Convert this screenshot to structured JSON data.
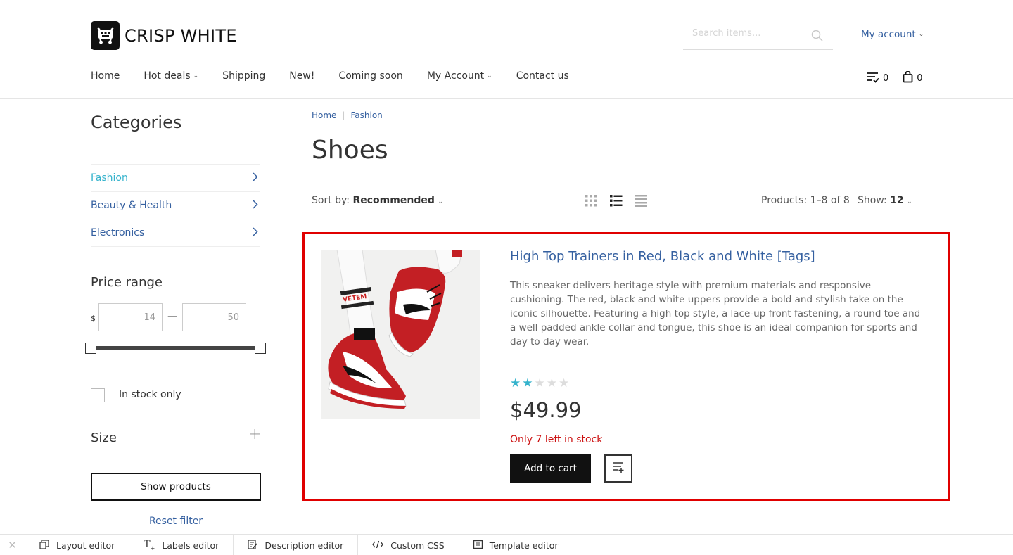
{
  "brand": {
    "name": "CRISP WHITE",
    "logo_icon": "cart-logo-icon"
  },
  "header": {
    "search_placeholder": "Search items...",
    "account_label": "My account",
    "favorites_count": "0",
    "cart_count": "0"
  },
  "nav": [
    {
      "label": "Home",
      "dropdown": false
    },
    {
      "label": "Hot deals",
      "dropdown": true
    },
    {
      "label": "Shipping",
      "dropdown": false
    },
    {
      "label": "New!",
      "dropdown": false
    },
    {
      "label": "Coming soon",
      "dropdown": false
    },
    {
      "label": "My Account",
      "dropdown": true
    },
    {
      "label": "Contact us",
      "dropdown": false
    }
  ],
  "sidebar": {
    "categories_title": "Categories",
    "categories": [
      {
        "label": "Fashion",
        "active": true
      },
      {
        "label": "Beauty & Health",
        "active": false
      },
      {
        "label": "Electronics",
        "active": false
      }
    ],
    "price_title": "Price range",
    "currency": "$",
    "price_min": "14",
    "price_max": "50",
    "in_stock_label": "In stock only",
    "size_title": "Size",
    "show_products_label": "Show products",
    "reset_label": "Reset filter"
  },
  "main": {
    "breadcrumb": [
      "Home",
      "Fashion"
    ],
    "title": "Shoes",
    "sort_prefix": "Sort by:",
    "sort_value": "Recommended",
    "products_count": "Products: 1–8 of 8",
    "show_prefix": "Show:",
    "show_value": "12"
  },
  "product": {
    "name": "High Top Trainers in Red, Black and White [Tags]",
    "description": "This sneaker delivers heritage style with premium materials and responsive cushioning. The red, black and white uppers provide a bold and stylish take on the iconic silhouette. Featuring a high top style, a lace-up front fastening, a round toe and a well padded ankle collar and tongue, this shoe is an ideal companion for sports and day to day wear.",
    "rating": 2,
    "rating_max": 5,
    "price": "$49.99",
    "stock_note": "Only 7 left in stock",
    "add_to_cart_label": "Add to cart",
    "sock_text": "VETEM",
    "accent_color": "#35b3cc",
    "highlight_color": "#e00000"
  },
  "toolbar": [
    {
      "label": "Layout editor",
      "icon": "layout-icon"
    },
    {
      "label": "Labels editor",
      "icon": "text-icon"
    },
    {
      "label": "Description editor",
      "icon": "edit-doc-icon"
    },
    {
      "label": "Custom CSS",
      "icon": "code-icon"
    },
    {
      "label": "Template editor",
      "icon": "template-icon"
    }
  ]
}
